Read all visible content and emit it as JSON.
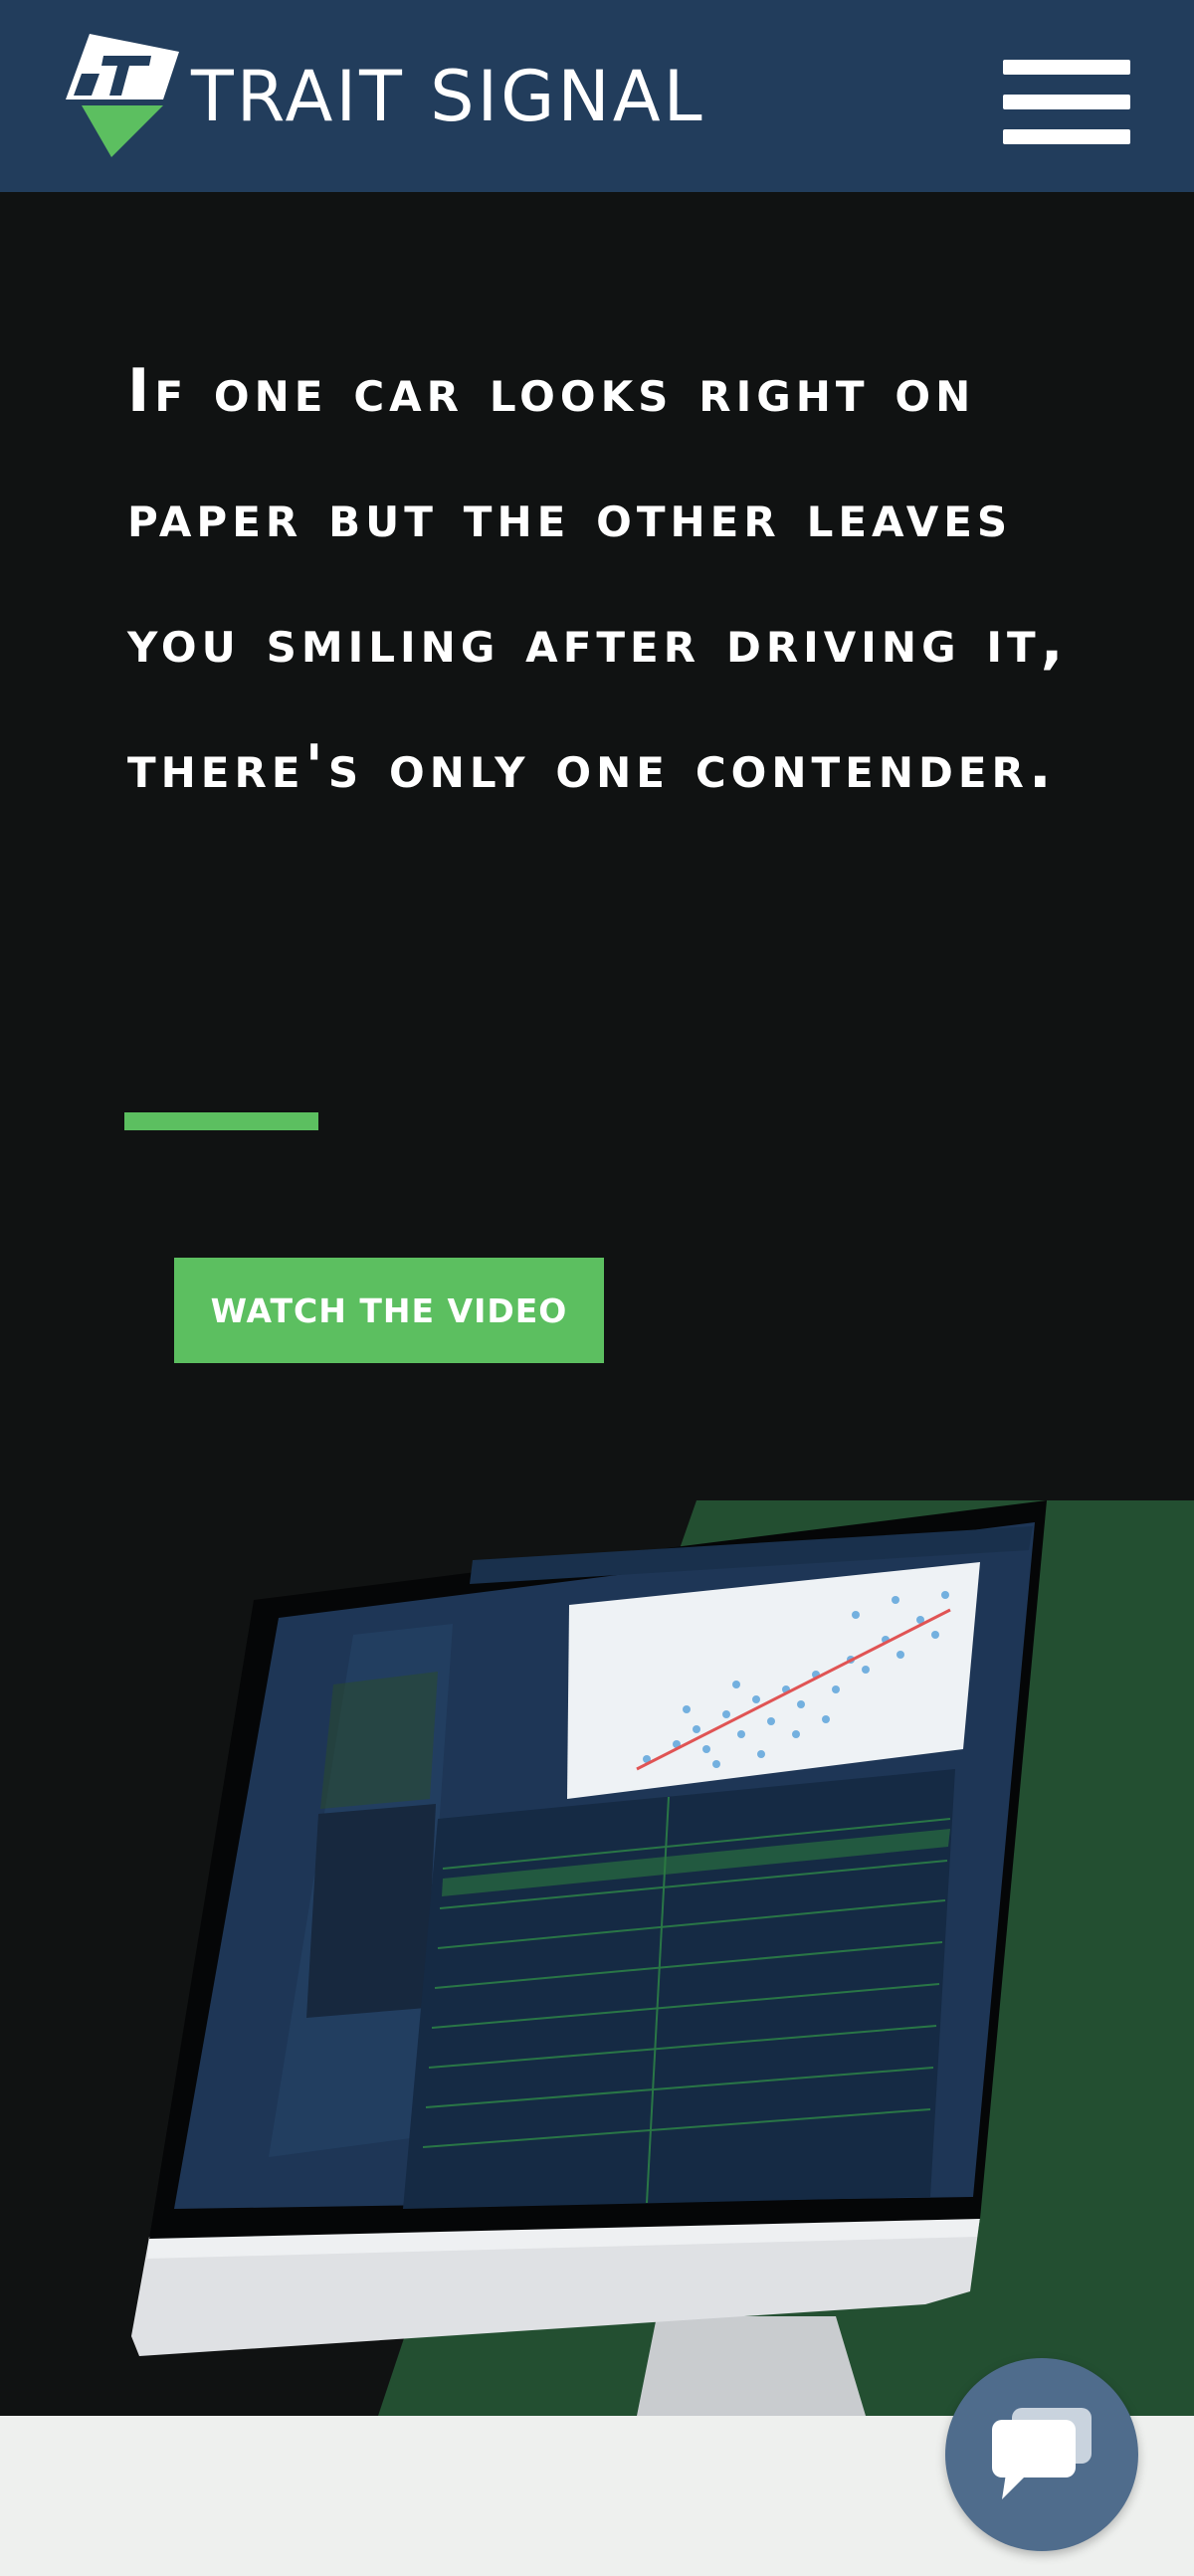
{
  "header": {
    "brand": "TRAIT SIGNAL",
    "logo_icon": "trait-signal-logo-icon",
    "menu_icon": "hamburger-menu-icon"
  },
  "hero": {
    "headline": "If one car looks right on paper but the other leaves you smiling after driving it, there's only one contender.",
    "cta_label": "WATCH THE VIDEO"
  },
  "colors": {
    "header_bg": "#223d5c",
    "hero_bg": "#101212",
    "accent_green": "#5cbf60",
    "panel_green": "#234f31",
    "chat_bg": "#4f6c8c"
  },
  "chat": {
    "icon": "chat-bubble-icon"
  }
}
